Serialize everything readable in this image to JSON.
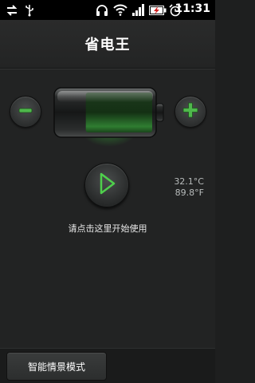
{
  "status_bar": {
    "time": "11:31",
    "icons": [
      "sync-arrows-icon",
      "usb-icon",
      "headset-icon",
      "wifi-icon",
      "signal-icon",
      "battery-charging-icon",
      "alarm-icon"
    ]
  },
  "header": {
    "title": "省电王"
  },
  "main": {
    "battery_level": 0.7,
    "temperature_c": "32.1°C",
    "temperature_f": "89.8°F",
    "hint": "请点击这里开始使用"
  },
  "bottom": {
    "mode_button_label": "智能情景模式"
  },
  "colors": {
    "accent_green": "#3fbf42",
    "background": "#222323",
    "statusbar": "#000000"
  }
}
